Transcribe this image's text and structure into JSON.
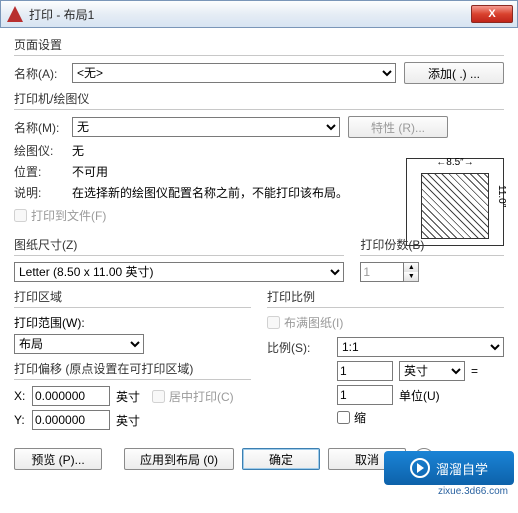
{
  "window": {
    "title": "打印 - 布局1",
    "close": "X"
  },
  "page_setup": {
    "group": "页面设置",
    "name_label": "名称(A):",
    "name_value": "<无>",
    "add_btn": "添加( .) ..."
  },
  "printer": {
    "group": "打印机/绘图仪",
    "name_label": "名称(M):",
    "name_value": "无",
    "props_btn": "特性 (R)...",
    "plotter_label": "绘图仪:",
    "plotter_value": "无",
    "location_label": "位置:",
    "location_value": "不可用",
    "desc_label": "说明:",
    "desc_value": "在选择新的绘图仪配置名称之前，不能打印该布局。",
    "to_file_label": "打印到文件(F)",
    "paper_w": "←8.5″→",
    "paper_h": "11.0″"
  },
  "paper_size": {
    "group": "图纸尺寸(Z)",
    "value": "Letter (8.50 x 11.00 英寸)"
  },
  "copies": {
    "group": "打印份数(B)",
    "value": "1"
  },
  "area": {
    "group": "打印区域",
    "range_label": "打印范围(W):",
    "range_value": "布局"
  },
  "offset": {
    "group": "打印偏移 (原点设置在可打印区域)",
    "x_label": "X:",
    "x_value": "0.000000",
    "y_label": "Y:",
    "y_value": "0.000000",
    "unit": "英寸",
    "center_label": "居中打印(C)"
  },
  "scale": {
    "group": "打印比例",
    "fit_label": "布满图纸(I)",
    "scale_label": "比例(S):",
    "scale_value": "1:1",
    "num_value": "1",
    "num_unit": "英寸",
    "den_value": "1",
    "den_unit": "单位(U)",
    "eq": "=",
    "lineweight_label": "缩"
  },
  "footer": {
    "preview": "预览 (P)...",
    "apply": "应用到布局 (0)",
    "ok": "确定",
    "cancel": "取消",
    "expand": ">"
  },
  "watermark": {
    "t1": "溜溜自学",
    "t2": "zixue.3d66.com"
  }
}
